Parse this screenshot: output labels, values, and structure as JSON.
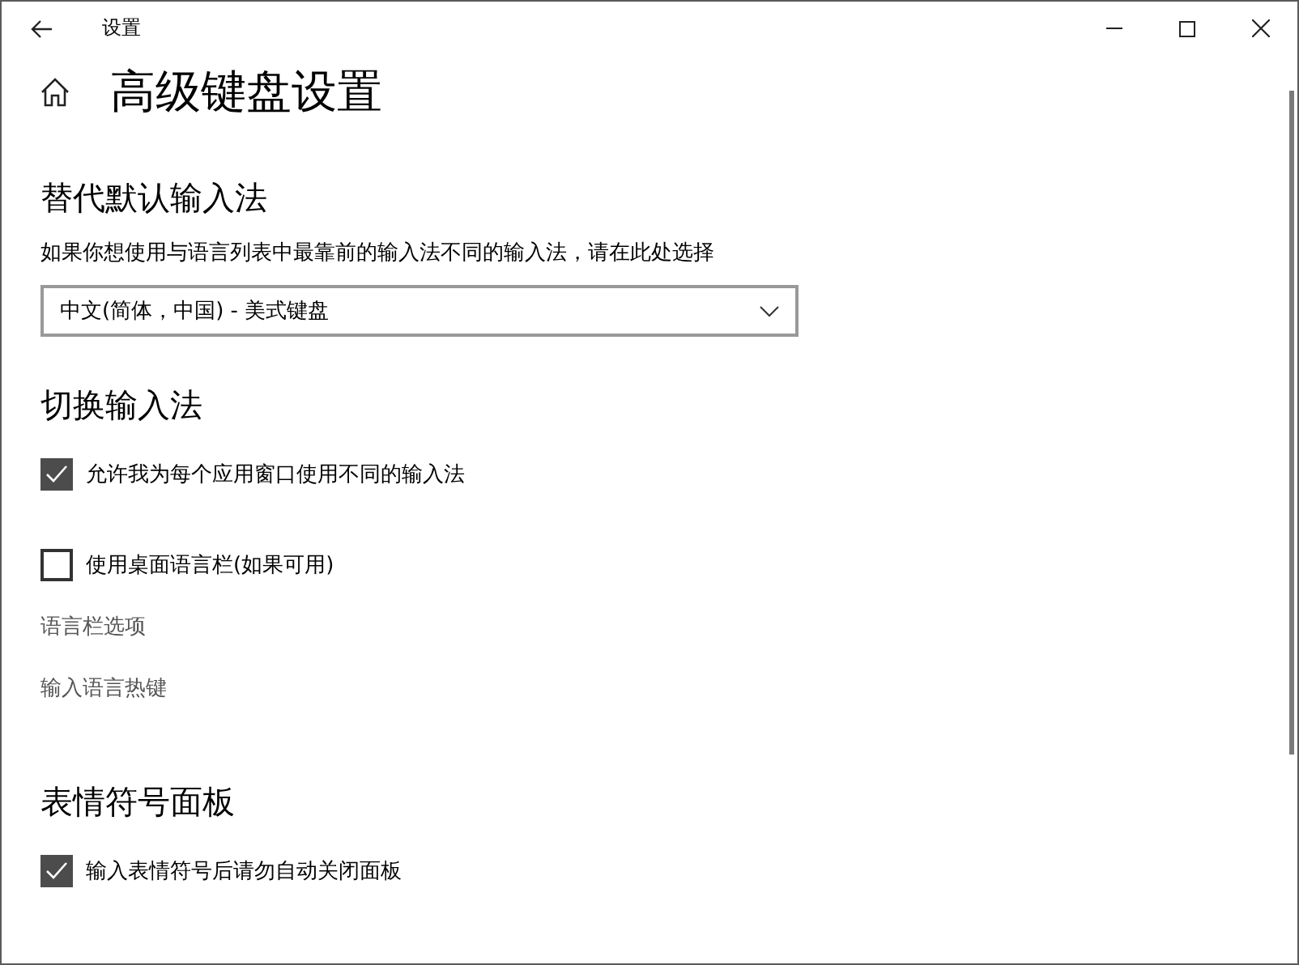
{
  "window": {
    "title": "设置"
  },
  "page": {
    "title": "高级键盘设置"
  },
  "sections": [
    {
      "title": "替代默认输入法",
      "items": [
        {
          "kind": "text",
          "label": "如果你想使用与语言列表中最靠前的输入法不同的输入法，请在此处选择"
        },
        {
          "kind": "dropdown",
          "value": "中文(简体，中国) - 美式键盘"
        }
      ]
    },
    {
      "title": "切换输入法",
      "items": [
        {
          "kind": "checkbox",
          "label": "允许我为每个应用窗口使用不同的输入法",
          "checked": true
        },
        {
          "kind": "checkbox",
          "label": "使用桌面语言栏(如果可用)",
          "checked": false
        },
        {
          "kind": "link",
          "label": "语言栏选项"
        },
        {
          "kind": "link",
          "label": "输入语言热键"
        }
      ]
    },
    {
      "title": "表情符号面板",
      "items": [
        {
          "kind": "checkbox",
          "label": "输入表情符号后请勿自动关闭面板",
          "checked": true
        }
      ]
    }
  ]
}
